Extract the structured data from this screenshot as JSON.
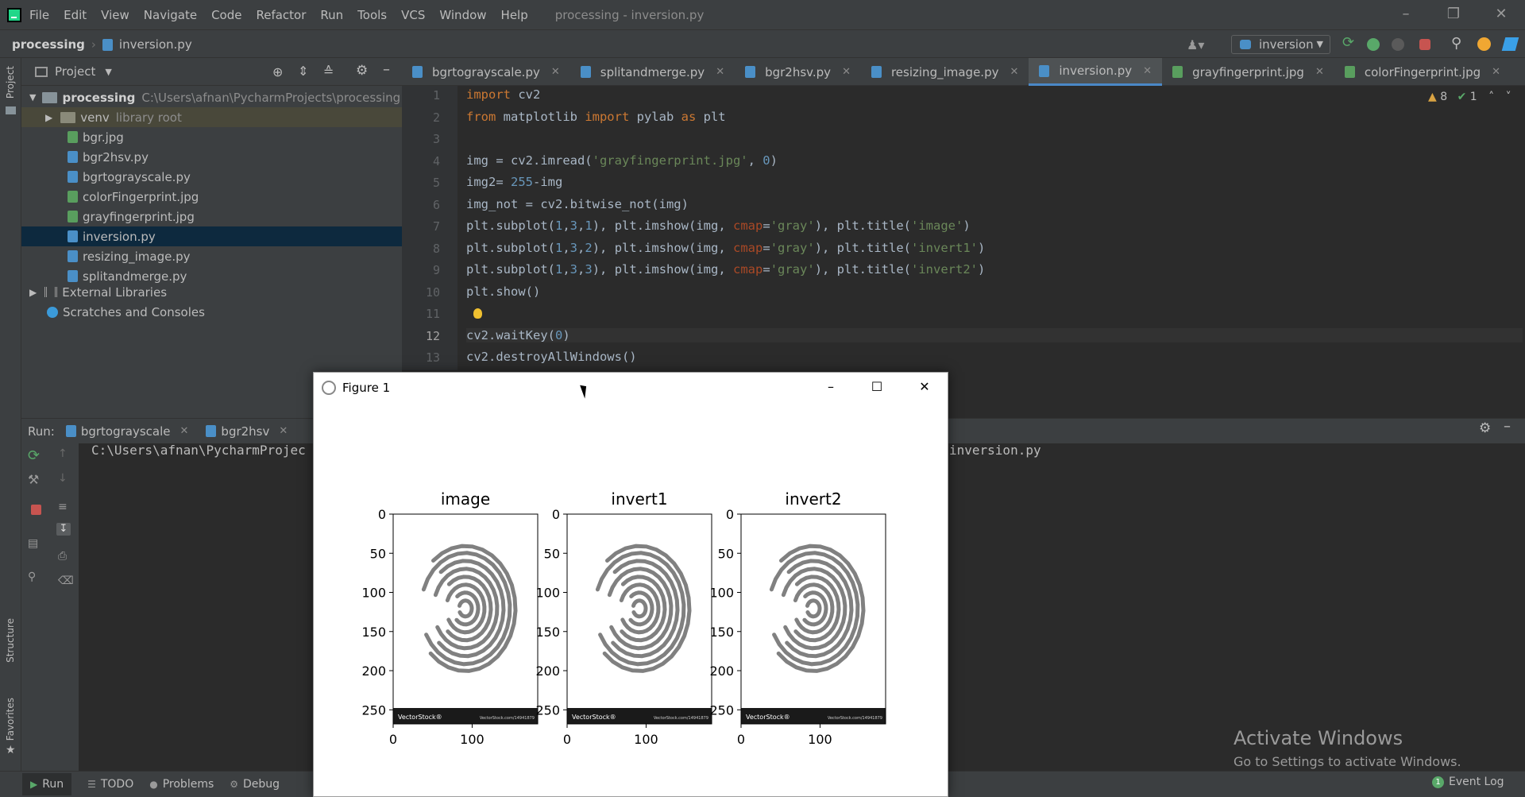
{
  "app": {
    "menu": [
      "File",
      "Edit",
      "View",
      "Navigate",
      "Code",
      "Refactor",
      "Run",
      "Tools",
      "VCS",
      "Window",
      "Help"
    ],
    "window_title": "processing - inversion.py"
  },
  "breadcrumb": {
    "project": "processing",
    "file": "inversion.py"
  },
  "run_config": "inversion",
  "project_panel": {
    "title": "Project",
    "root": {
      "name": "processing",
      "path": "C:\\Users\\afnan\\PycharmProjects\\processing"
    },
    "venv": {
      "name": "venv",
      "hint": "library root"
    },
    "files": [
      "bgr.jpg",
      "bgr2hsv.py",
      "bgrtograyscale.py",
      "colorFingerprint.jpg",
      "grayfingerprint.jpg",
      "inversion.py",
      "resizing_image.py",
      "splitandmerge.py"
    ],
    "external": "External Libraries",
    "scratches": "Scratches and Consoles"
  },
  "editor": {
    "tabs": [
      "bgrtograyscale.py",
      "splitandmerge.py",
      "bgr2hsv.py",
      "resizing_image.py",
      "inversion.py",
      "grayfingerprint.jpg",
      "colorFingerprint.jpg"
    ],
    "active_tab": "inversion.py",
    "inspections": {
      "warnings": "8",
      "ok": "1"
    },
    "line_numbers": [
      "1",
      "2",
      "3",
      "4",
      "5",
      "6",
      "7",
      "8",
      "9",
      "10",
      "11",
      "12",
      "13"
    ]
  },
  "run_panel": {
    "label": "Run:",
    "tabs": [
      "bgrtograyscale",
      "bgr2hsv"
    ],
    "console_left": "C:\\Users\\afnan\\PycharmProjec",
    "console_right": "inversion.py"
  },
  "status_tabs": [
    "Run",
    "TODO",
    "Problems",
    "Debug"
  ],
  "event_log": {
    "count": "1",
    "label": "Event Log"
  },
  "left_strip": {
    "project": "Project",
    "structure": "Structure",
    "favorites": "Favorites"
  },
  "watermark": {
    "title": "Activate Windows",
    "subtitle": "Go to Settings to activate Windows."
  },
  "figure_window": {
    "title": "Figure 1"
  },
  "chart_data": [
    {
      "type": "heatmap",
      "title": "image",
      "xlabel": "",
      "ylabel": "",
      "xticks": [
        "0",
        "100"
      ],
      "yticks": [
        "0",
        "50",
        "100",
        "150",
        "200",
        "250"
      ],
      "xlim": [
        0,
        183
      ],
      "ylim": [
        0,
        268
      ],
      "image_text": [
        "VectorStock®",
        "VectorStock.com/14941879"
      ]
    },
    {
      "type": "heatmap",
      "title": "invert1",
      "xlabel": "",
      "ylabel": "",
      "xticks": [
        "0",
        "100"
      ],
      "yticks": [
        "0",
        "50",
        "100",
        "150",
        "200",
        "250"
      ],
      "xlim": [
        0,
        183
      ],
      "ylim": [
        0,
        268
      ],
      "image_text": [
        "VectorStock®",
        "VectorStock.com/14941879"
      ]
    },
    {
      "type": "heatmap",
      "title": "invert2",
      "xlabel": "",
      "ylabel": "",
      "xticks": [
        "0",
        "100"
      ],
      "yticks": [
        "0",
        "50",
        "100",
        "150",
        "200",
        "250"
      ],
      "xlim": [
        0,
        183
      ],
      "ylim": [
        0,
        268
      ],
      "image_text": [
        "VectorStock®",
        "VectorStock.com/14941879"
      ]
    }
  ],
  "colors": {
    "editor_bg": "#2b2b2b",
    "panel_bg": "#3c3f41",
    "keyword": "#cc7832",
    "string": "#6a8759",
    "number": "#6897bb",
    "selection": "#0d293e"
  }
}
